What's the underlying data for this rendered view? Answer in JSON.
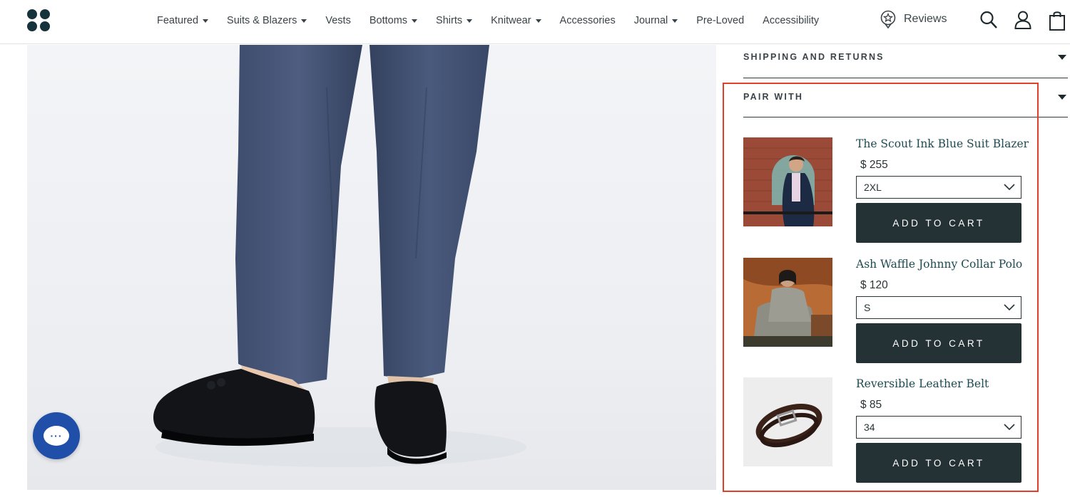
{
  "nav": {
    "items": [
      {
        "label": "Featured",
        "dropdown": true
      },
      {
        "label": "Suits & Blazers",
        "dropdown": true
      },
      {
        "label": "Vests",
        "dropdown": false
      },
      {
        "label": "Bottoms",
        "dropdown": true
      },
      {
        "label": "Shirts",
        "dropdown": true
      },
      {
        "label": "Knitwear",
        "dropdown": true
      },
      {
        "label": "Accessories",
        "dropdown": false
      },
      {
        "label": "Journal",
        "dropdown": true
      },
      {
        "label": "Pre-Loved",
        "dropdown": false
      },
      {
        "label": "Accessibility",
        "dropdown": false
      }
    ],
    "reviews_label": "Reviews",
    "icons": [
      "logo-icon",
      "star-badge-icon",
      "search-icon",
      "account-icon",
      "cart-bag-icon"
    ]
  },
  "accordion": {
    "shipping": "SHIPPING AND RETURNS",
    "pair_with": "PAIR WITH"
  },
  "pair_items": [
    {
      "name": "The Scout Ink Blue Suit Blazer",
      "price": "$ 255",
      "size": "2XL",
      "button": "ADD TO CART"
    },
    {
      "name": "Ash Waffle Johnny Collar Polo",
      "price": "$ 120",
      "size": "S",
      "button": "ADD TO CART"
    },
    {
      "name": "Reversible Leather Belt",
      "price": "$ 85",
      "size": "34",
      "button": "ADD TO CART"
    }
  ],
  "colors": {
    "brand": "#16323a",
    "button_bg": "#243236",
    "link": "#1e4b52",
    "highlight": "#e0402a",
    "chat": "#1f4fa8"
  }
}
